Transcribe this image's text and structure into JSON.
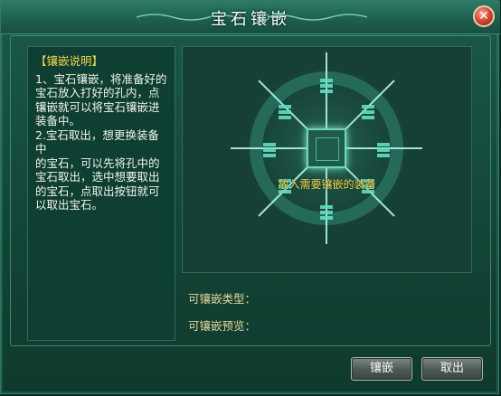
{
  "window": {
    "title": "宝石镶嵌",
    "close_label": "✕"
  },
  "instructions": {
    "heading": "【镶嵌说明】",
    "lines": [
      "1、宝石镶嵌，将准备好的",
      "宝石放入打好的孔内，点",
      "镶嵌就可以将宝石镶嵌进",
      "装备中。",
      "2.宝石取出，想更换装备中",
      "的宝石，可以先将孔中的",
      "宝石取出，选中想要取出",
      "的宝石，点取出按钮就可",
      "以取出宝石。"
    ]
  },
  "equip_slot": {
    "hint": "放入需要镶嵌的装备"
  },
  "info": {
    "type_label": "可镶嵌类型：",
    "preview_label": "可镶嵌预览："
  },
  "buttons": {
    "inlay": "镶嵌",
    "remove": "取出"
  }
}
